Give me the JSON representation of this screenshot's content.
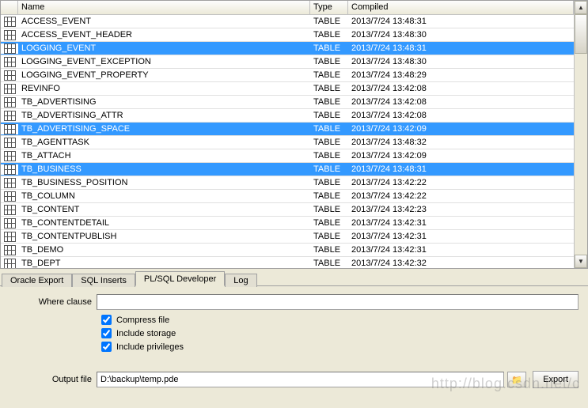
{
  "columns": {
    "name": "Name",
    "type": "Type",
    "compiled": "Compiled"
  },
  "rows": [
    {
      "name": "ACCESS_EVENT",
      "type": "TABLE",
      "compiled": "2013/7/24 13:48:31",
      "selected": false
    },
    {
      "name": "ACCESS_EVENT_HEADER",
      "type": "TABLE",
      "compiled": "2013/7/24 13:48:30",
      "selected": false
    },
    {
      "name": "LOGGING_EVENT",
      "type": "TABLE",
      "compiled": "2013/7/24 13:48:31",
      "selected": true
    },
    {
      "name": "LOGGING_EVENT_EXCEPTION",
      "type": "TABLE",
      "compiled": "2013/7/24 13:48:30",
      "selected": false
    },
    {
      "name": "LOGGING_EVENT_PROPERTY",
      "type": "TABLE",
      "compiled": "2013/7/24 13:48:29",
      "selected": false
    },
    {
      "name": "REVINFO",
      "type": "TABLE",
      "compiled": "2013/7/24 13:42:08",
      "selected": false
    },
    {
      "name": "TB_ADVERTISING",
      "type": "TABLE",
      "compiled": "2013/7/24 13:42:08",
      "selected": false
    },
    {
      "name": "TB_ADVERTISING_ATTR",
      "type": "TABLE",
      "compiled": "2013/7/24 13:42:08",
      "selected": false
    },
    {
      "name": "TB_ADVERTISING_SPACE",
      "type": "TABLE",
      "compiled": "2013/7/24 13:42:09",
      "selected": true
    },
    {
      "name": "TB_AGENTTASK",
      "type": "TABLE",
      "compiled": "2013/7/24 13:48:32",
      "selected": false
    },
    {
      "name": "TB_ATTACH",
      "type": "TABLE",
      "compiled": "2013/7/24 13:42:09",
      "selected": false
    },
    {
      "name": "TB_BUSINESS",
      "type": "TABLE",
      "compiled": "2013/7/24 13:48:31",
      "selected": true
    },
    {
      "name": "TB_BUSINESS_POSITION",
      "type": "TABLE",
      "compiled": "2013/7/24 13:42:22",
      "selected": false
    },
    {
      "name": "TB_COLUMN",
      "type": "TABLE",
      "compiled": "2013/7/24 13:42:22",
      "selected": false
    },
    {
      "name": "TB_CONTENT",
      "type": "TABLE",
      "compiled": "2013/7/24 13:42:23",
      "selected": false
    },
    {
      "name": "TB_CONTENTDETAIL",
      "type": "TABLE",
      "compiled": "2013/7/24 13:42:31",
      "selected": false
    },
    {
      "name": "TB_CONTENTPUBLISH",
      "type": "TABLE",
      "compiled": "2013/7/24 13:42:31",
      "selected": false
    },
    {
      "name": "TB_DEMO",
      "type": "TABLE",
      "compiled": "2013/7/24 13:42:31",
      "selected": false
    },
    {
      "name": "TB_DEPT",
      "type": "TABLE",
      "compiled": "2013/7/24 13:42:32",
      "selected": false
    }
  ],
  "tabs": {
    "oracle_export": "Oracle Export",
    "sql_inserts": "SQL Inserts",
    "plsql_developer": "PL/SQL Developer",
    "log": "Log",
    "active": "plsql_developer"
  },
  "form": {
    "where_label": "Where clause",
    "where_value": "",
    "compress_label": "Compress file",
    "compress_checked": true,
    "storage_label": "Include storage",
    "storage_checked": true,
    "privileges_label": "Include privileges",
    "privileges_checked": true,
    "output_label": "Output file",
    "output_value": "D:\\backup\\temp.pde",
    "export_button": "Export"
  },
  "watermark": "http://blog.csdn.net/c"
}
